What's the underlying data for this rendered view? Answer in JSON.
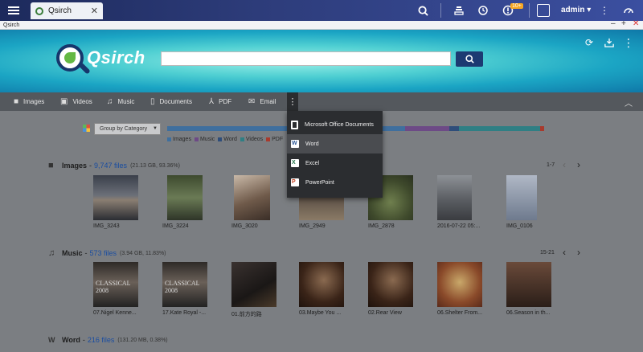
{
  "system_bar": {
    "tab_title": "Qsirch",
    "notification_badge": "10+",
    "user": "admin"
  },
  "window": {
    "title": "Qsirch"
  },
  "banner": {
    "logo_text": "Qsirch",
    "search_placeholder": ""
  },
  "categories": [
    {
      "label": "Images",
      "icon": "camera-icon"
    },
    {
      "label": "Videos",
      "icon": "video-icon"
    },
    {
      "label": "Music",
      "icon": "music-icon"
    },
    {
      "label": "Documents",
      "icon": "document-icon"
    },
    {
      "label": "PDF",
      "icon": "pdf-icon"
    },
    {
      "label": "Email",
      "icon": "email-icon"
    }
  ],
  "document_menu": [
    {
      "label": "Microsoft Office Documents",
      "icon": "office-icon",
      "active": false
    },
    {
      "label": "Word",
      "icon": "word-icon",
      "active": true
    },
    {
      "label": "Excel",
      "icon": "excel-icon",
      "active": false
    },
    {
      "label": "PowerPoint",
      "icon": "powerpoint-icon",
      "active": false
    }
  ],
  "group_select": {
    "value": "Group by Category"
  },
  "usage_legend": [
    "Images",
    "Music",
    "Word",
    "Videos",
    "PDF"
  ],
  "colors": {
    "images": "#4a86c5",
    "music": "#9b59b6",
    "word": "#2b5797",
    "videos": "#3aa0a8",
    "pdf": "#c0392b",
    "search_button": "#1c3a72"
  },
  "sections": {
    "images": {
      "title": "Images",
      "files": "9,747 files",
      "size": "(21.13 GB, 93.36%)",
      "pager": "1-7",
      "items": [
        "IMG_3243",
        "IMG_3224",
        "IMG_3020",
        "IMG_2949",
        "IMG_2878",
        "2016-07-22 05:...",
        "IMG_0106"
      ]
    },
    "music": {
      "title": "Music",
      "files": "573 files",
      "size": "(3.94 GB, 11.83%)",
      "pager": "15-21",
      "items": [
        "07.Nigel Kenne...",
        "17.Kate Royal -...",
        "01.前方的路",
        "03.Maybe You ...",
        "02.Rear View",
        "06.Shelter From...",
        "06.Season in th..."
      ],
      "album_text": "CLASSICAL 2008"
    },
    "word": {
      "title": "Word",
      "files": "216 files",
      "size": "(131.20 MB, 0.38%)"
    }
  }
}
